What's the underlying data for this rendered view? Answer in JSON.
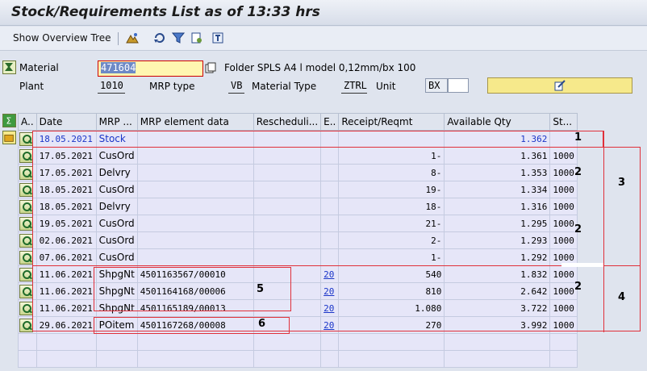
{
  "title": "Stock/Requirements List as of 13:33 hrs",
  "toolbar": {
    "overview_tree": "Show Overview Tree"
  },
  "header": {
    "material_label": "Material",
    "material_value": "471604",
    "material_desc": "Folder SPLS A4 l model 0,12mm/bx 100",
    "plant_label": "Plant",
    "plant_value": "1010",
    "mrp_type_label": "MRP type",
    "mrp_type_value": "VB",
    "material_type_label": "Material Type",
    "material_type_value": "ZTRL",
    "unit_label": "Unit",
    "unit_value": "BX"
  },
  "columns": [
    "A..",
    "Date",
    "MRP ...",
    "MRP element data",
    "Rescheduli...",
    "E..",
    "Receipt/Reqmt",
    "Available Qty",
    "St..."
  ],
  "rows": [
    {
      "date": "18.05.2021",
      "mrp": "Stock",
      "data": "",
      "resch": "",
      "e": "",
      "rr": "",
      "avail": "1.362",
      "st": "",
      "stock": true
    },
    {
      "date": "17.05.2021",
      "mrp": "CusOrd",
      "data": "",
      "resch": "",
      "e": "",
      "rr": "1-",
      "avail": "1.361",
      "st": "1000"
    },
    {
      "date": "17.05.2021",
      "mrp": "Delvry",
      "data": "",
      "resch": "",
      "e": "",
      "rr": "8-",
      "avail": "1.353",
      "st": "1000"
    },
    {
      "date": "18.05.2021",
      "mrp": "CusOrd",
      "data": "",
      "resch": "",
      "e": "",
      "rr": "19-",
      "avail": "1.334",
      "st": "1000"
    },
    {
      "date": "18.05.2021",
      "mrp": "Delvry",
      "data": "",
      "resch": "",
      "e": "",
      "rr": "18-",
      "avail": "1.316",
      "st": "1000"
    },
    {
      "date": "19.05.2021",
      "mrp": "CusOrd",
      "data": "",
      "resch": "",
      "e": "",
      "rr": "21-",
      "avail": "1.295",
      "st": "1000"
    },
    {
      "date": "02.06.2021",
      "mrp": "CusOrd",
      "data": "",
      "resch": "",
      "e": "",
      "rr": "2-",
      "avail": "1.293",
      "st": "1000"
    },
    {
      "date": "07.06.2021",
      "mrp": "CusOrd",
      "data": "",
      "resch": "",
      "e": "",
      "rr": "1-",
      "avail": "1.292",
      "st": "1000"
    },
    {
      "date": "11.06.2021",
      "mrp": "ShpgNt",
      "data": "4501163567/00010",
      "resch": "",
      "e": "20",
      "rr": "540",
      "avail": "1.832",
      "st": "1000"
    },
    {
      "date": "11.06.2021",
      "mrp": "ShpgNt",
      "data": "4501164168/00006",
      "resch": "",
      "e": "20",
      "rr": "810",
      "avail": "2.642",
      "st": "1000"
    },
    {
      "date": "11.06.2021",
      "mrp": "ShpgNt",
      "data": "4501165189/00013",
      "resch": "",
      "e": "20",
      "rr": "1.080",
      "avail": "3.722",
      "st": "1000"
    },
    {
      "date": "29.06.2021",
      "mrp": "POitem",
      "data": "4501167268/00008",
      "resch": "",
      "e": "20",
      "rr": "270",
      "avail": "3.992",
      "st": "1000"
    }
  ],
  "annotations": [
    "1",
    "2",
    "3",
    "2",
    "2",
    "4",
    "5",
    "6"
  ]
}
